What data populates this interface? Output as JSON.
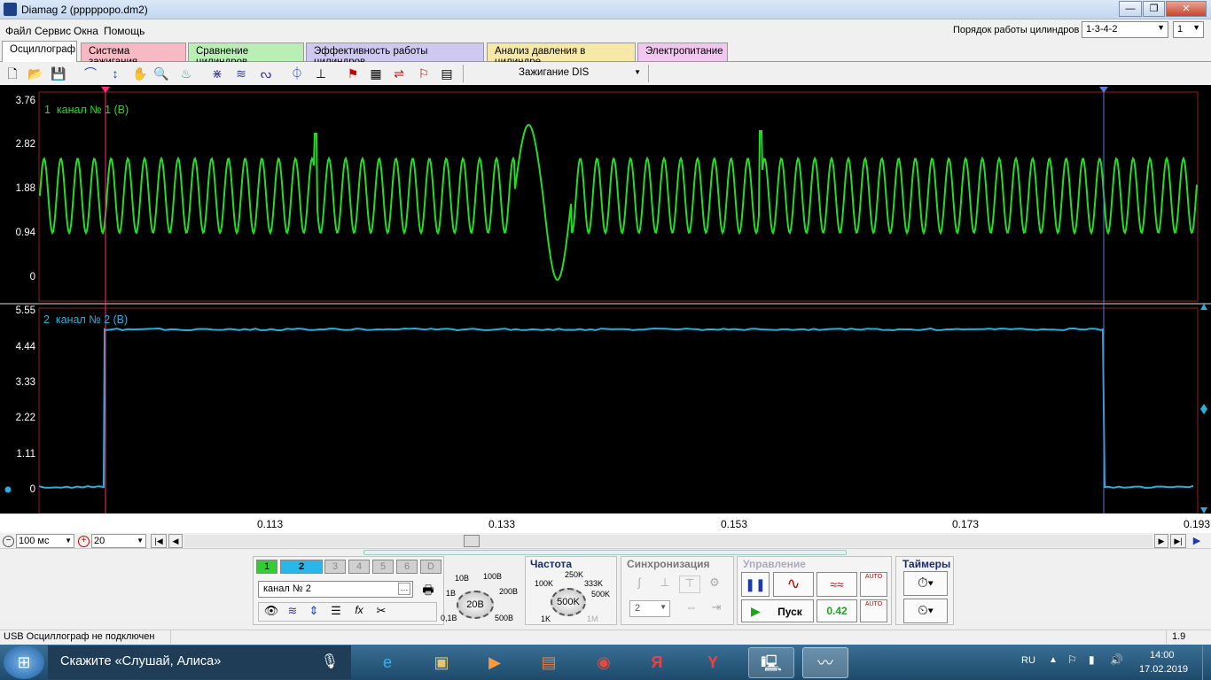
{
  "window": {
    "title": "Diamag 2 (pppppopo.dm2)",
    "min": "—",
    "max": "❐",
    "close": "✕"
  },
  "menu": [
    "Файл",
    "Сервис",
    "Окна",
    "Помощь"
  ],
  "cylinder_order": {
    "label": "Порядок работы цилиндров",
    "value": "1-3-4-2",
    "spin": "1"
  },
  "tabs": [
    {
      "label": "Осциллограф",
      "color": "#ffffff"
    },
    {
      "label": "Система зажигания",
      "color": "#f7b9c4"
    },
    {
      "label": "Сравнение цилиндров",
      "color": "#b9efb5"
    },
    {
      "label": "Эффективность работы цилиндров",
      "color": "#cfc9f2"
    },
    {
      "label": "Анализ давления в цилиндре",
      "color": "#f6e9a8"
    },
    {
      "label": "Электропитание",
      "color": "#f2c7ef"
    }
  ],
  "toolbar": {
    "mode_select": "Зажигание DIS"
  },
  "channel1": {
    "label": "1  канал № 1 (В)",
    "color": "#22dd22",
    "yticks": [
      "3.76",
      "2.82",
      "1.88",
      "0.94",
      "0"
    ]
  },
  "channel2": {
    "label": "2  канал № 2 (В)",
    "color": "#29aee0",
    "yticks": [
      "5.55",
      "4.44",
      "3.33",
      "2.22",
      "1.11",
      "0"
    ]
  },
  "xticks": [
    "0.113",
    "0.133",
    "0.153",
    "0.173",
    "0.193"
  ],
  "timebase": {
    "value": "100 мс",
    "count": "20"
  },
  "channels": {
    "buttons": [
      "1",
      "2",
      "3",
      "4",
      "5",
      "6",
      "D"
    ],
    "name": "канал № 2"
  },
  "volt_knob": {
    "value": "20В",
    "labels": [
      "10В",
      "100В",
      "1В",
      "200В",
      "0,1В",
      "500В"
    ]
  },
  "freq": {
    "title": "Частота",
    "value": "500K",
    "labels": [
      "250K",
      "100K",
      "333K",
      "500K",
      "1K",
      "1M"
    ]
  },
  "sync": {
    "title": "Синхронизация",
    "select": "2"
  },
  "control": {
    "title": "Управление",
    "start": "Пуск",
    "value": "0.42",
    "auto": "AUTO"
  },
  "timers": {
    "title": "Таймеры"
  },
  "status": {
    "text": "USB Осциллограф не подключен",
    "version": "1.9"
  },
  "taskbar": {
    "search": "Скажите «Слушай, Алиса»",
    "lang": "RU",
    "time": "14:00",
    "date": "17.02.2019"
  }
}
